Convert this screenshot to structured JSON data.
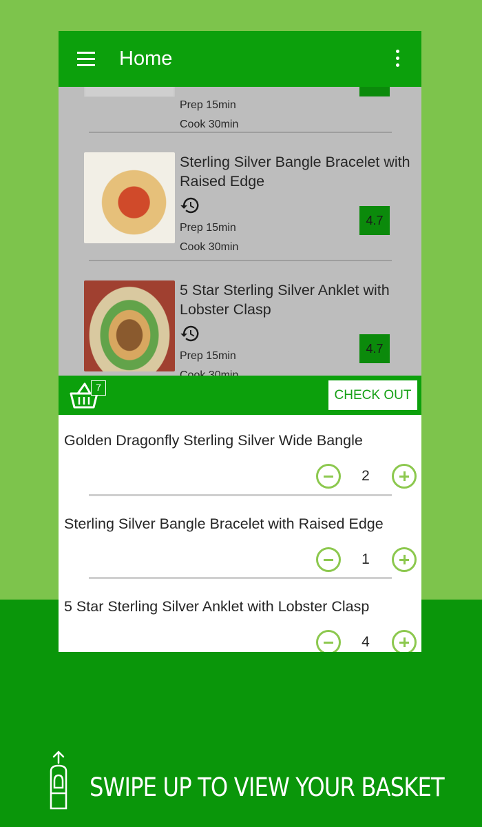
{
  "appbar": {
    "title": "Home"
  },
  "recipes": [
    {
      "title": "",
      "prep": "Prep 15min",
      "cook": "Cook 30min",
      "rating": ""
    },
    {
      "title": "Sterling Silver Bangle Bracelet with Raised Edge",
      "prep": "Prep 15min",
      "cook": "Cook 30min",
      "rating": "4.7"
    },
    {
      "title": "5 Star Sterling Silver Anklet with Lobster Clasp",
      "prep": "Prep 15min",
      "cook": "Cook 30min",
      "rating": "4.7"
    }
  ],
  "basket": {
    "count": "7",
    "checkout_label": "CHECK OUT",
    "items": [
      {
        "name": "Golden Dragonfly Sterling Silver Wide Bangle",
        "qty": "2"
      },
      {
        "name": "Sterling Silver Bangle Bracelet with Raised Edge",
        "qty": "1"
      },
      {
        "name": "5 Star Sterling Silver Anklet with Lobster Clasp",
        "qty": "4"
      }
    ]
  },
  "swipe": {
    "label": "SWIPE UP TO VIEW YOUR BASKET"
  },
  "colors": {
    "primary": "#0ca00c",
    "light_green": "#7dc44c",
    "accent": "#8cc84e",
    "rating_bg": "#0b8a0b"
  }
}
